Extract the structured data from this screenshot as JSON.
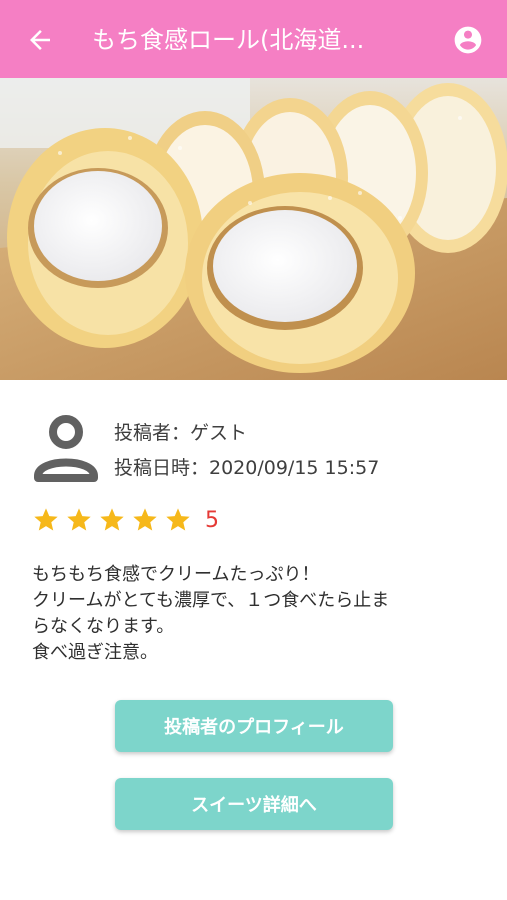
{
  "appbar": {
    "title": "もち食感ロール(北海道...",
    "back_icon": "arrow-left-icon",
    "account_icon": "account-circle-icon",
    "color": "#f57fc4"
  },
  "hero_image": {
    "alt": "roll-cake-photo"
  },
  "author": {
    "poster_line": "投稿者：ゲスト",
    "date_line": "投稿日時：2020/09/15 15:57",
    "avatar_icon": "person-icon"
  },
  "rating": {
    "stars": 5,
    "value": "5",
    "star_color": "#f6b81a"
  },
  "comment": {
    "lines": [
      "もちもち食感でクリームたっぷり！",
      "クリームがとても濃厚で、１つ食べたら止ま",
      "らなくなります。",
      "食べ過ぎ注意。"
    ]
  },
  "buttons": {
    "profile_label": "投稿者のプロフィール",
    "detail_label": "スイーツ詳細へ",
    "color": "#7dd5cb"
  }
}
